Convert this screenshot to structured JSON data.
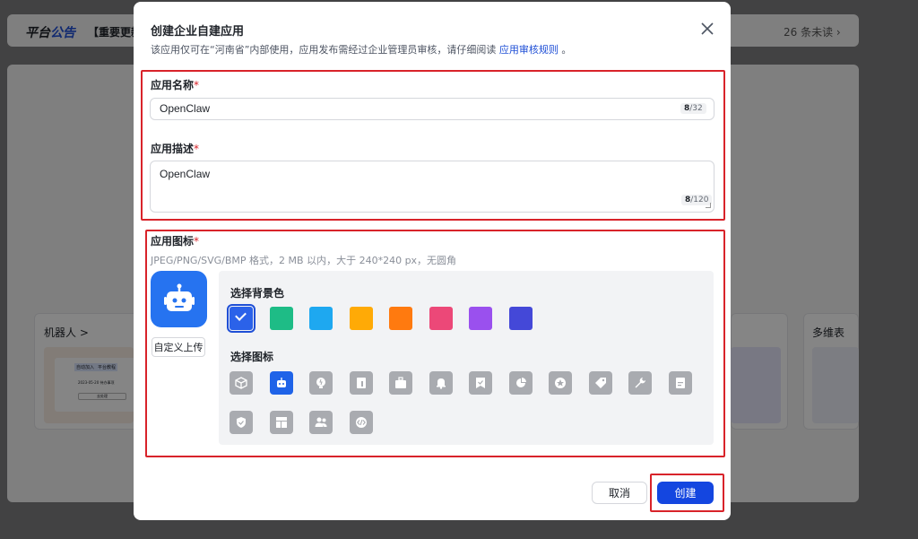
{
  "background": {
    "brand_main": "平台",
    "brand_accent": "公告",
    "notice_text": "【重要更新",
    "unread": "26 条未读",
    "unread_chevron": "chevron-right-icon",
    "card_left_title": "机器人 >",
    "card_right_title": "多维表",
    "thumb_chip_1": "自动加入",
    "thumb_chip_2": "平台教程",
    "thumb_line": "2023-05-20 待办事项",
    "thumb_button": "去处理"
  },
  "dialog": {
    "title": "创建企业自建应用",
    "subtitle_prefix": "该应用仅可在“河南省”内部使用，应用发布需经过企业管理员审核，请仔细阅读",
    "subtitle_link": "应用审核规则",
    "subtitle_suffix": "。",
    "close_icon": "close-icon"
  },
  "form": {
    "name_label": "应用名称",
    "name_value": "OpenClaw",
    "name_count": "8",
    "name_max": "/32",
    "desc_label": "应用描述",
    "desc_value": "OpenClaw",
    "desc_count": "8",
    "desc_max": "/120",
    "required_mark": "*",
    "icon_label": "应用图标",
    "icon_hint": "JPEG/PNG/SVG/BMP 格式，2 MB 以内，大于 240*240 px，无圆角",
    "upload_label": "自定义上传",
    "preview_icon": "robot-icon",
    "bg_color_label": "选择背景色",
    "icon_select_label": "选择图标",
    "colors": [
      "#2b62e9",
      "#1ebc86",
      "#1ea8f0",
      "#ffaa06",
      "#ff7a0f",
      "#ec4878",
      "#9a50ee",
      "#4448d8"
    ],
    "selected_color_index": 0,
    "icons": [
      "cube-icon",
      "robot-icon",
      "lightbulb-icon",
      "chart-icon",
      "briefcase-icon",
      "bell-icon",
      "bookmark-icon",
      "pie-chart-icon",
      "star-icon",
      "tag-icon",
      "wrench-icon",
      "document-icon",
      "shield-check-icon",
      "layout-icon",
      "team-icon",
      "code-icon"
    ],
    "selected_icon_index": 1
  },
  "footer": {
    "cancel_label": "取消",
    "create_label": "创建"
  },
  "colors": {
    "accent": "#1446e0",
    "highlight_red": "#d8232a",
    "preview_bg": "#2673f0"
  }
}
